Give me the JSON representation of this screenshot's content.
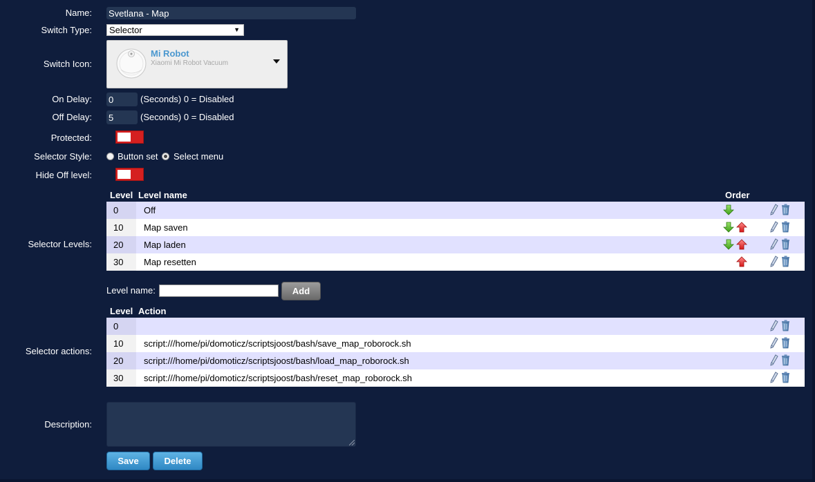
{
  "form": {
    "name_label": "Name:",
    "name_value": "Svetlana - Map",
    "switch_type_label": "Switch Type:",
    "switch_type_value": "Selector",
    "switch_icon_label": "Switch Icon:",
    "icon_title": "Mi Robot",
    "icon_subtitle": "Xiaomi Mi Robot Vacuum",
    "on_delay_label": "On Delay:",
    "on_delay_value": "0",
    "off_delay_label": "Off Delay:",
    "off_delay_value": "5",
    "delay_hint": "(Seconds) 0 = Disabled",
    "protected_label": "Protected:",
    "selector_style_label": "Selector Style:",
    "style_option_buttonset": "Button set",
    "style_option_selectmenu": "Select menu",
    "hide_off_label": "Hide Off level:",
    "selector_levels_label": "Selector Levels:",
    "selector_actions_label": "Selector actions:",
    "description_label": "Description:"
  },
  "levels_table": {
    "headers": {
      "level": "Level",
      "name": "Level name",
      "order": "Order"
    },
    "rows": [
      {
        "level": "0",
        "name": "Off"
      },
      {
        "level": "10",
        "name": "Map saven"
      },
      {
        "level": "20",
        "name": "Map laden"
      },
      {
        "level": "30",
        "name": "Map resetten"
      }
    ]
  },
  "level_add": {
    "label": "Level name:",
    "button": "Add"
  },
  "actions_table": {
    "headers": {
      "level": "Level",
      "action": "Action"
    },
    "rows": [
      {
        "level": "0",
        "action": ""
      },
      {
        "level": "10",
        "action": "script:///home/pi/domoticz/scriptsjoost/bash/save_map_roborock.sh"
      },
      {
        "level": "20",
        "action": "script:///home/pi/domoticz/scriptsjoost/bash/load_map_roborock.sh"
      },
      {
        "level": "30",
        "action": "script:///home/pi/domoticz/scriptsjoost/bash/reset_map_roborock.sh"
      }
    ]
  },
  "buttons": {
    "save": "Save",
    "delete": "Delete"
  },
  "colors": {
    "background": "#0f1d3c",
    "toggle_off": "#d52020",
    "button_blue": "#2f88c4",
    "row_alt": "#e1e1ff"
  }
}
